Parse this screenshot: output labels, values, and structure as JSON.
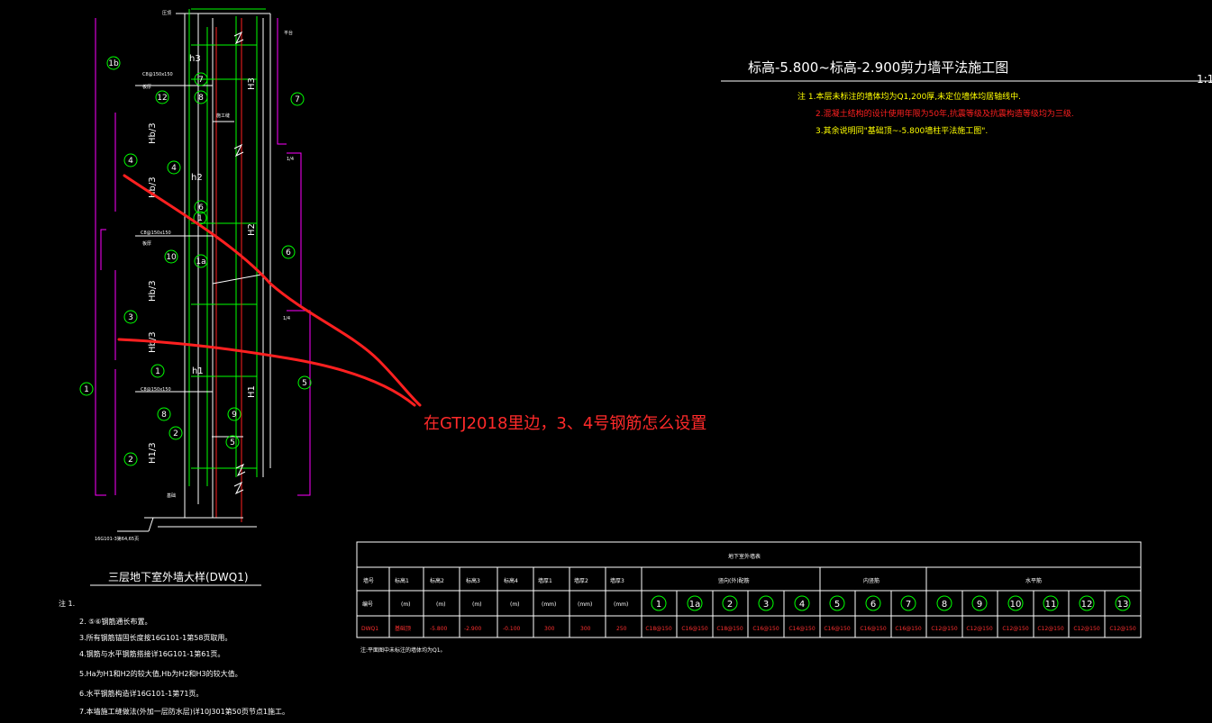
{
  "colors": {
    "background": "#000000",
    "line_white": "#ffffff",
    "line_green": "#00ff00",
    "line_red": "#ff2020",
    "line_magenta": "#ff00ff",
    "text_yellow": "#ffff00",
    "annotation_red": "#ff2a2a"
  },
  "title_block": {
    "title": "标高-5.800~标高-2.900剪力墙平法施工图",
    "scale": "1:1",
    "notes": [
      "注 1.本层未标注的墙体均为Q1,200厚,未定位墙体均居轴线中.",
      "2.混凝土结构的设计使用年限为50年,抗震等级及抗震构造等级均为三级.",
      "3.其余说明同\"基础顶~-5.800墙柱平法施工图\"."
    ]
  },
  "detail": {
    "caption": "三层地下室外墙大样(DWQ1)",
    "elevation_labels": [
      "H1",
      "H2",
      "H3",
      "h1",
      "h2",
      "h3",
      "Hb/3",
      "Hb/3",
      "Hb/3",
      "Hb/3",
      "H1/3"
    ],
    "bar_tags": [
      "1",
      "2",
      "3",
      "4",
      "5",
      "6",
      "7",
      "8",
      "9",
      "10",
      "12",
      "1a",
      "4",
      "2"
    ],
    "footnote": "16G101-3第64,65页",
    "notes_heading": "注 1.",
    "notes": [
      "2. ⑤⑥钢筋通长布置。",
      "3.所有钢筋锚固长度按16G101-1第58页取用。",
      "4.钢筋与水平钢筋搭接详16G101-1第61页。",
      "5.Ha为H1和H2的较大值,Hb为H2和H3的较大值。",
      "6.水平钢筋构造详16G101-1第71页。",
      "7.本墙施工缝做法(外加一层防水层)详10J301第50页节点1施工。"
    ]
  },
  "table": {
    "title": "地下室外墙表",
    "headers": [
      "墙号",
      "标高1",
      "标高2",
      "标高3",
      "标高4",
      "墙厚1",
      "墙厚2",
      "墙厚3"
    ],
    "units": [
      "",
      "(m)",
      "(m)",
      "(m)",
      "(m)",
      "(mm)",
      "(mm)",
      "(mm)"
    ],
    "groups": [
      "竖向(外)配筋",
      "内竖筋",
      "水平筋"
    ],
    "bar_numbers": [
      "1",
      "1a",
      "2",
      "3",
      "4",
      "5",
      "6",
      "7",
      "8",
      "9",
      "10",
      "11",
      "12",
      "13"
    ],
    "row": [
      "DWQ1",
      "基础顶",
      "-5.800",
      "-2.900",
      "-0.100",
      "300",
      "300",
      "250"
    ],
    "bars": [
      "C18@150",
      "C16@150",
      "C18@150",
      "C16@150",
      "C14@150",
      "C16@150",
      "C16@150",
      "C16@150",
      "C12@150",
      "C12@150",
      "C12@150",
      "C12@150",
      "C12@150",
      "C12@150"
    ],
    "footnote": "注:平面图中未标注的墙体均为Q1。"
  },
  "annotation": {
    "question": "在GTJ2018里边，3、4号钢筋怎么设置"
  }
}
